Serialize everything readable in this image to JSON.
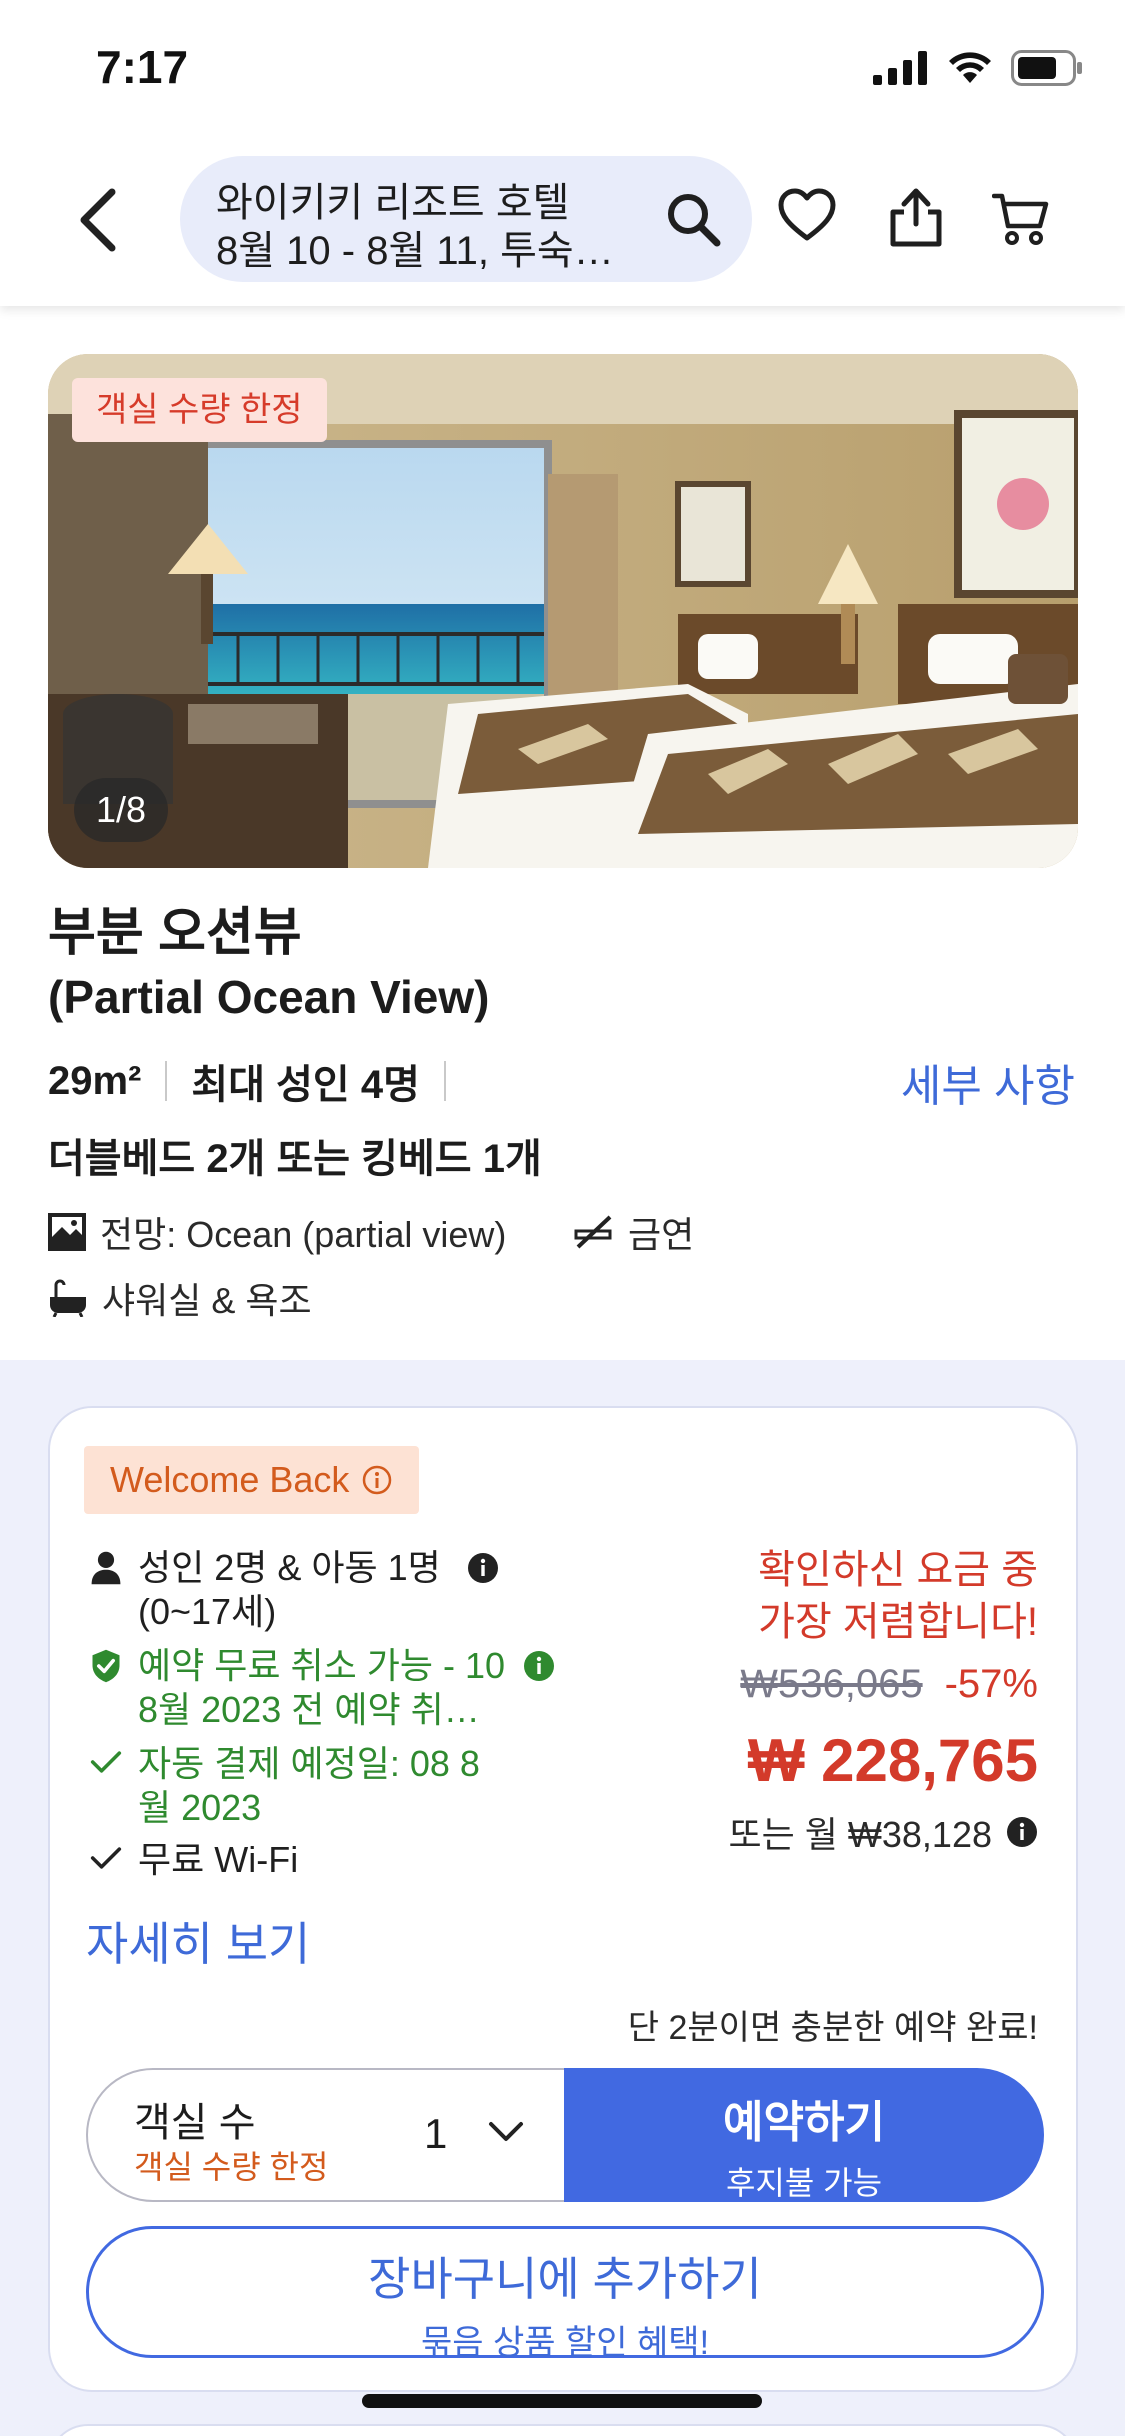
{
  "status_bar": {
    "time": "7:17"
  },
  "header": {
    "search_title": "와이키키 리조트 호텔",
    "search_subtitle": "8월 10 - 8월 11, 투숙…",
    "icons": [
      "back-chevron-icon",
      "search-icon",
      "heart-icon",
      "share-icon",
      "cart-icon"
    ]
  },
  "room": {
    "limited_tag": "객실 수량 한정",
    "photo_counter": "1/8",
    "name_ko": "부분 오션뷰",
    "name_en": "(Partial Ocean View)",
    "size": "29m²",
    "capacity": "최대 성인 4명",
    "details_link": "세부 사항",
    "beds": "더블베드 2개 또는 킹베드 1개",
    "amenities": {
      "view": "전망: Ocean (partial view)",
      "smoking": "금연",
      "bath": "샤워실 & 욕조"
    }
  },
  "offer": {
    "welcome_badge": "Welcome Back",
    "guests_line1": "성인 2명 & 아동 1명",
    "guests_line2": "(0~17세)",
    "cancel_line1": "예약 무료 취소 가능 - 10",
    "cancel_line2": "8월 2023 전 예약 취…",
    "autopay_line1": "자동 결제 예정일: 08 8",
    "autopay_line2": "월 2023",
    "wifi": "무료 Wi-Fi",
    "more_link": "자세히 보기",
    "price_note_line1": "확인하신 요금 중",
    "price_note_line2": "가장 저렴합니다!",
    "original_price": "₩536,065",
    "discount": "-57%",
    "price": "₩ 228,765",
    "monthly": "또는 월 ₩38,128",
    "quick_note": "단 2분이면 충분한 예약 완료!",
    "room_count_label": "객실 수",
    "room_count_sub": "객실 수량 한정",
    "room_count_value": "1",
    "book_label": "예약하기",
    "book_sub": "후지불 가능",
    "cart_label": "장바구니에 추가하기",
    "cart_sub": "묶음 상품 할인 혜택!"
  },
  "colors": {
    "accent_blue": "#4169e1",
    "price_red": "#d33a2a",
    "benefit_green": "#2f8a2f",
    "badge_orange": "#d35b1d"
  }
}
